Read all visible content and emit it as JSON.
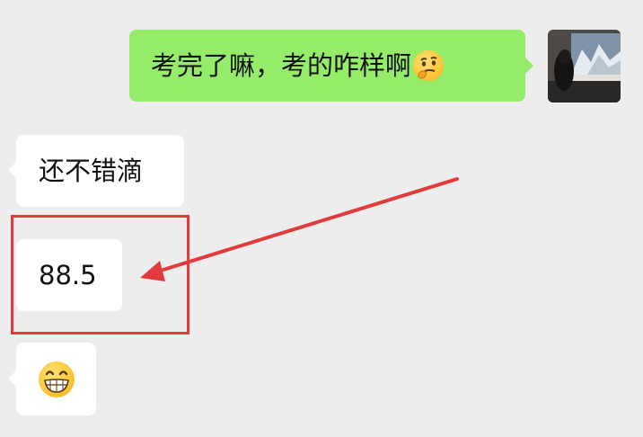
{
  "chat": {
    "messages": [
      {
        "direction": "outgoing",
        "text": "考完了嘛，考的咋样啊",
        "emoji": "thinking-face-icon"
      },
      {
        "direction": "incoming",
        "text": "还不错滴"
      },
      {
        "direction": "incoming",
        "text": "88.5"
      },
      {
        "direction": "incoming",
        "emoji": "grinning-face-icon"
      }
    ]
  },
  "colors": {
    "background": "#ededed",
    "incoming_bubble": "#ffffff",
    "outgoing_bubble": "#95ec69",
    "annotation": "#e23b3b"
  },
  "annotation": {
    "highlighted_message": "88.5"
  }
}
